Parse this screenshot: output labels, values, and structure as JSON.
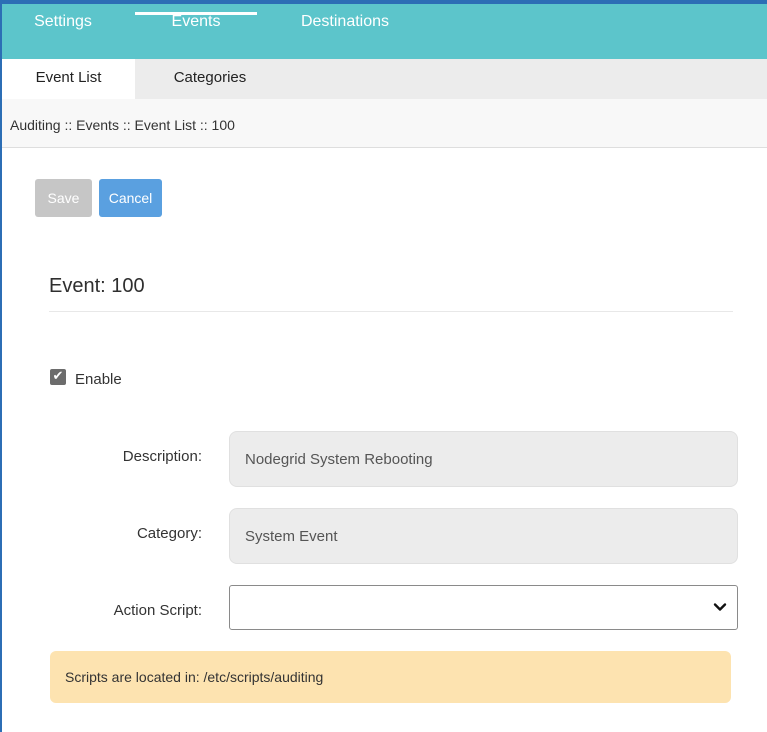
{
  "topnav": {
    "tabs": [
      {
        "label": "Settings"
      },
      {
        "label": "Events"
      },
      {
        "label": "Destinations"
      }
    ]
  },
  "subnav": {
    "tabs": [
      {
        "label": "Event List"
      },
      {
        "label": "Categories"
      }
    ]
  },
  "breadcrumb": "Auditing :: Events :: Event List :: 100",
  "toolbar": {
    "save_label": "Save",
    "cancel_label": "Cancel"
  },
  "form": {
    "title": "Event: 100",
    "enable_label": "Enable",
    "enable_checked": true,
    "description_label": "Description:",
    "description_value": "Nodegrid System Rebooting",
    "category_label": "Category:",
    "category_value": "System Event",
    "action_script_label": "Action Script:",
    "action_script_value": ""
  },
  "notice": "Scripts are located in: /etc/scripts/auditing",
  "colors": {
    "topnav_bg": "#5cc5cb",
    "accent_border": "#2c6eb5",
    "cancel_button": "#5aa0e0",
    "save_button_disabled": "#c6c6c6",
    "notice_bg": "#fde3b0"
  },
  "icons": {
    "checkbox": "check-icon",
    "select": "chevron-down-icon"
  }
}
